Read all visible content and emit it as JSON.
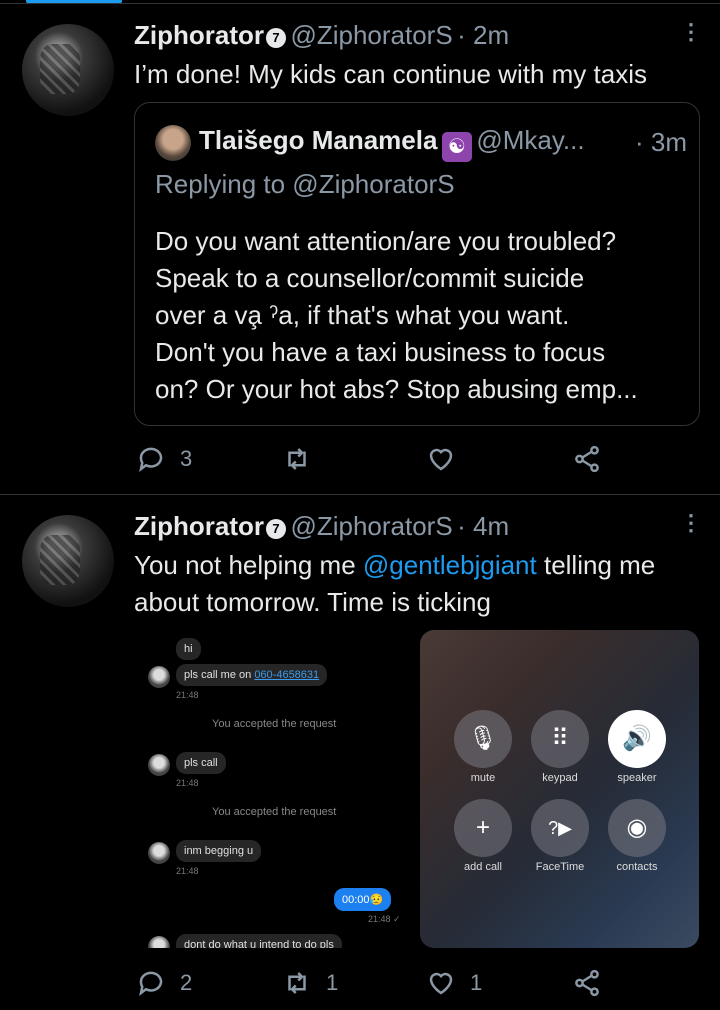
{
  "tweets": [
    {
      "name": "Ziphorator",
      "verified_glyph": "7",
      "handle": "@ZiphoratorS",
      "time": "· 2m",
      "text": "I’m done! My kids can continue with my taxis",
      "quote": {
        "name": "Tlaišego Manamela",
        "badge": "☯",
        "handle": "@Mkay...",
        "time": "· 3m",
        "replying": "Replying to @ZiphoratorS",
        "lines": [
          "Do you want attention/are you troubled?",
          "Speak to a counsellor/commit suicide",
          "over a va̧ ˀa, if that's what you want.",
          "Don't you have a taxi business to focus",
          "on? Or your hot abs? Stop abusing emp..."
        ]
      },
      "actions": {
        "replies": "3",
        "retweets": "",
        "likes": ""
      }
    },
    {
      "name": "Ziphorator",
      "verified_glyph": "7",
      "handle": "@ZiphoratorS",
      "time": "· 4m",
      "text_part1": "You not helping me ",
      "mention": "@gentlebjgiant",
      "text_part2": " telling me",
      "text_line2": "about tomorrow. Time is ticking",
      "chat": {
        "msg1": "hi",
        "msg2_prefix": "pls call me on ",
        "msg2_link": "060-4658631",
        "time1": "21:48",
        "system1": "You accepted the request",
        "msg3": "pls call",
        "time2": "21:48",
        "system2": "You accepted the request",
        "msg4": "inm begging u",
        "time3": "21:48",
        "sent": "00:00😥",
        "sent_time": "21:48 ✓",
        "msg5": "dont do what u intend to do pls"
      },
      "call": {
        "buttons": [
          {
            "label": "mute",
            "icon": "mic-off-icon"
          },
          {
            "label": "keypad",
            "icon": "keypad-icon"
          },
          {
            "label": "speaker",
            "icon": "speaker-icon"
          },
          {
            "label": "add call",
            "icon": "plus-icon"
          },
          {
            "label": "FaceTime",
            "icon": "facetime-icon"
          },
          {
            "label": "contacts",
            "icon": "contacts-icon"
          }
        ]
      },
      "actions": {
        "replies": "2",
        "retweets": "1",
        "likes": "1"
      }
    }
  ],
  "colors": {
    "background": "#000000",
    "text": "#e7e9ea",
    "secondary": "#8b98a5",
    "accent": "#1d9bf0",
    "divider": "#2f3336"
  }
}
